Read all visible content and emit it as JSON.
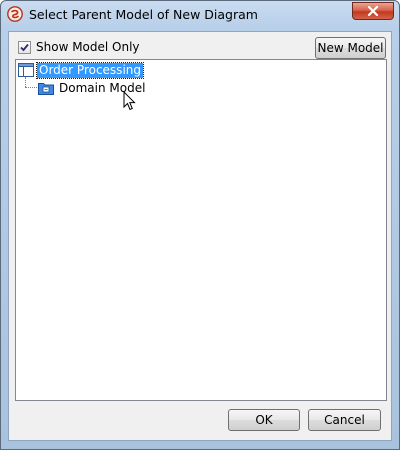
{
  "window": {
    "title": "Select Parent Model of New Diagram"
  },
  "options": {
    "show_model_only_label": "Show Model Only",
    "show_model_only_checked": true
  },
  "toolbar": {
    "new_model_label": "New Model"
  },
  "tree": {
    "root": {
      "label": "Order Processing",
      "selected": true,
      "icon": "diagram-icon"
    },
    "children": [
      {
        "label": "Domain Model",
        "icon": "model-folder-icon"
      }
    ]
  },
  "footer": {
    "ok_label": "OK",
    "cancel_label": "Cancel"
  },
  "colors": {
    "selection": "#3399ff",
    "close_button": "#c23a1f"
  }
}
